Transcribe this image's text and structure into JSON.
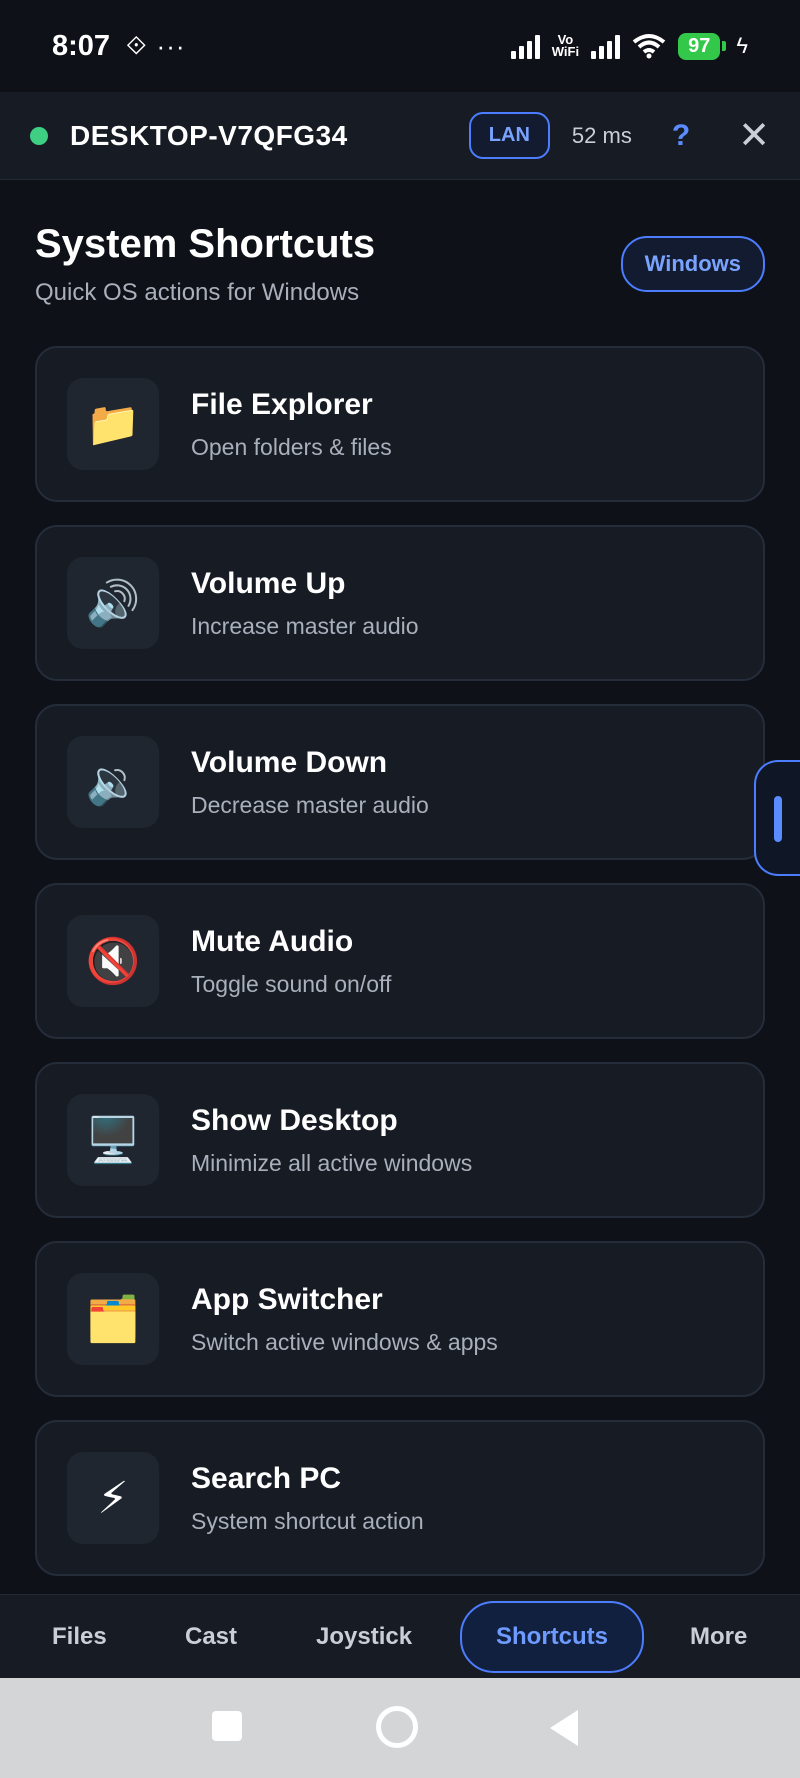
{
  "status_bar": {
    "time": "8:07",
    "glyph": "⟐",
    "dots": "···",
    "vo_wifi_top": "Vo",
    "vo_wifi_bottom": "WiFi",
    "battery": "97",
    "bolt": "ϟ"
  },
  "connection": {
    "hostname": "DESKTOP-V7QFG34",
    "status_color": "#3ecf83",
    "network_badge": "LAN",
    "latency": "52 ms",
    "help_label": "?",
    "close_label": "✕"
  },
  "header": {
    "title": "System Shortcuts",
    "subtitle": "Quick OS actions for Windows",
    "os_badge": "Windows"
  },
  "shortcuts": [
    {
      "icon": "📁",
      "icon_name": "folder-icon",
      "title": "File Explorer",
      "desc": "Open folders & files"
    },
    {
      "icon": "🔊",
      "icon_name": "speaker-loud-icon",
      "title": "Volume Up",
      "desc": "Increase master audio"
    },
    {
      "icon": "🔉",
      "icon_name": "speaker-low-icon",
      "title": "Volume Down",
      "desc": "Decrease master audio"
    },
    {
      "icon": "🔇",
      "icon_name": "speaker-muted-icon",
      "title": "Mute Audio",
      "desc": "Toggle sound on/off"
    },
    {
      "icon": "🖥️",
      "icon_name": "desktop-computer-icon",
      "title": "Show Desktop",
      "desc": "Minimize all active windows"
    },
    {
      "icon": "🗂️",
      "icon_name": "card-index-dividers-icon",
      "title": "App Switcher",
      "desc": "Switch active windows & apps"
    },
    {
      "icon": "⚡",
      "icon_name": "lightning-icon",
      "title": "Search PC",
      "desc": "System shortcut action"
    }
  ],
  "bottom_nav": {
    "tabs": [
      "Files",
      "Cast",
      "Joystick",
      "Shortcuts",
      "More"
    ],
    "active": "Shortcuts"
  },
  "colors": {
    "accent": "#4c7dff",
    "background": "#0e1117",
    "card": "#161b24"
  }
}
